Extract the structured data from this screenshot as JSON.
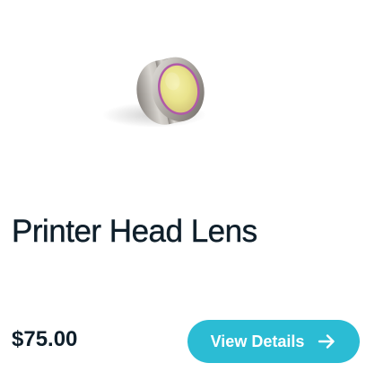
{
  "product": {
    "image_icon": "lens-icon",
    "title": "Printer Head Lens",
    "price": "$75.00"
  },
  "actions": {
    "view_details_label": "View Details",
    "view_details_icon": "arrow-right-icon"
  },
  "colors": {
    "accent": "#2bbcd4",
    "text": "#0f1f2b",
    "background": "#ffffff"
  }
}
